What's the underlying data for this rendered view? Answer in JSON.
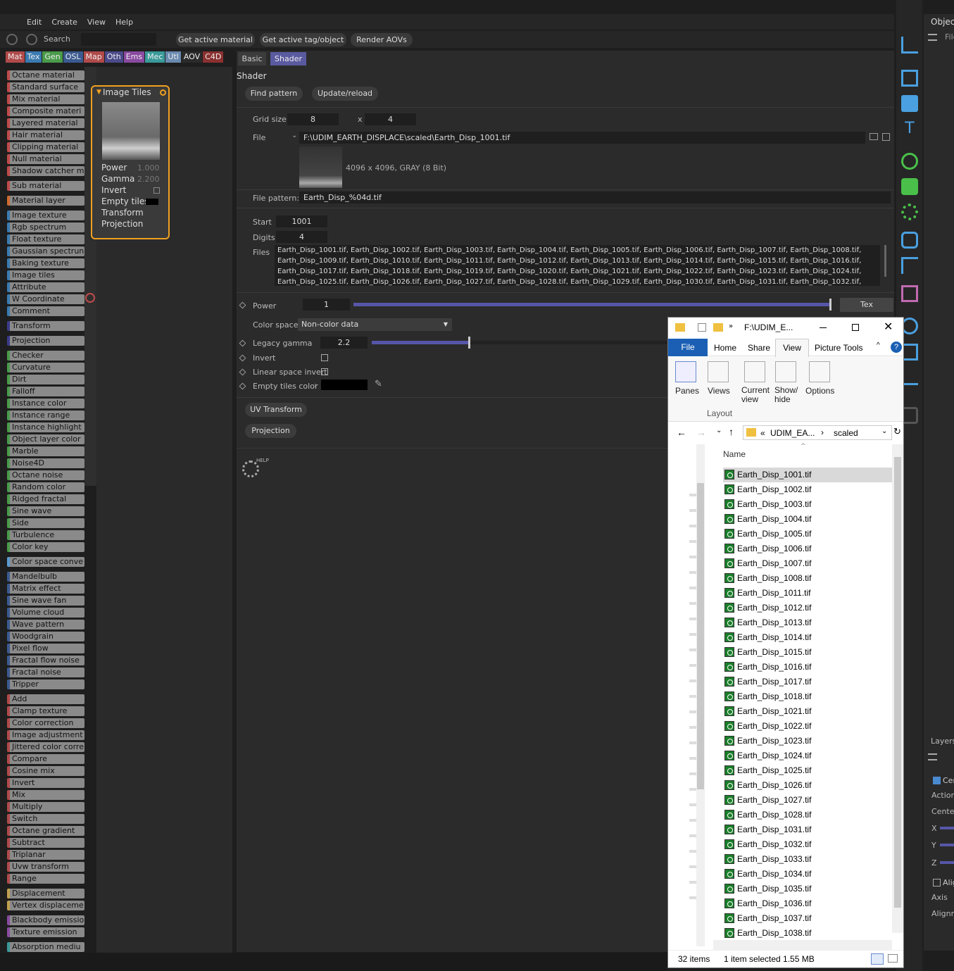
{
  "menu": [
    "Edit",
    "Create",
    "View",
    "Help"
  ],
  "toolbar": {
    "search_label": "Search",
    "get_active_material": "Get active material",
    "get_active_tag": "Get active tag/object",
    "render_aovs": "Render AOVs"
  },
  "tabs": [
    {
      "label": "Mat",
      "color": "#b04a4a"
    },
    {
      "label": "Tex",
      "color": "#3a7ab0"
    },
    {
      "label": "Gen",
      "color": "#4a9a4a"
    },
    {
      "label": "OSL",
      "color": "#3a5a90"
    },
    {
      "label": "Map",
      "color": "#b04a4a"
    },
    {
      "label": "Oth",
      "color": "#4a4a8a"
    },
    {
      "label": "Ems",
      "color": "#8a4aa0"
    },
    {
      "label": "Mec",
      "color": "#3a9a9a"
    },
    {
      "label": "Utl",
      "color": "#6a8ab0"
    },
    {
      "label": "AOV",
      "color": "#2a2a2a"
    },
    {
      "label": "C4D",
      "color": "#8a3030"
    }
  ],
  "node_list": [
    [
      "Octane material",
      "#c04a4a"
    ],
    [
      "Standard surface",
      "#c04a4a"
    ],
    [
      "Mix material",
      "#c04a4a"
    ],
    [
      "Composite materi",
      "#c04a4a"
    ],
    [
      "Layered material",
      "#c04a4a"
    ],
    [
      "Hair material",
      "#c04a4a"
    ],
    [
      "Clipping material",
      "#c04a4a"
    ],
    [
      "Null material",
      "#c04a4a"
    ],
    [
      "Shadow catcher m",
      "#c04a4a"
    ],
    [
      "Sub material",
      "#c04a4a"
    ],
    [
      "Material layer",
      "#d06a30"
    ],
    [
      "Image texture",
      "#3a7ab0"
    ],
    [
      "Rgb spectrum",
      "#3a7ab0"
    ],
    [
      "Float texture",
      "#3a7ab0"
    ],
    [
      "Gaussian spectrun",
      "#3a7ab0"
    ],
    [
      "Baking texture",
      "#3a7ab0"
    ],
    [
      "Image tiles",
      "#3a7ab0"
    ],
    [
      "Attribute",
      "#3a7ab0"
    ],
    [
      "W Coordinate",
      "#3a7ab0"
    ],
    [
      "Comment",
      "#3a7ab0"
    ],
    [
      "Transform",
      "#3a3a8a"
    ],
    [
      "Projection",
      "#3a3a8a"
    ],
    [
      "Checker",
      "#4a9a4a"
    ],
    [
      "Curvature",
      "#4a9a4a"
    ],
    [
      "Dirt",
      "#4a9a4a"
    ],
    [
      "Falloff",
      "#4a9a4a"
    ],
    [
      "Instance color",
      "#4a9a4a"
    ],
    [
      "Instance range",
      "#4a9a4a"
    ],
    [
      "Instance highlight",
      "#4a9a4a"
    ],
    [
      "Object layer color",
      "#4a9a4a"
    ],
    [
      "Marble",
      "#4a9a4a"
    ],
    [
      "Noise4D",
      "#4a9a4a"
    ],
    [
      "Octane noise",
      "#4a9a4a"
    ],
    [
      "Random color",
      "#4a9a4a"
    ],
    [
      "Ridged fractal",
      "#4a9a4a"
    ],
    [
      "Sine wave",
      "#4a9a4a"
    ],
    [
      "Side",
      "#4a9a4a"
    ],
    [
      "Turbulence",
      "#4a9a4a"
    ],
    [
      "Color key",
      "#4a9a4a"
    ],
    [
      "Color space conve",
      "#5a9ad0"
    ],
    [
      "Mandelbulb",
      "#3a5a90"
    ],
    [
      "Matrix effect",
      "#3a5a90"
    ],
    [
      "Sine wave fan",
      "#3a5a90"
    ],
    [
      "Volume cloud",
      "#3a5a90"
    ],
    [
      "Wave pattern",
      "#3a5a90"
    ],
    [
      "Woodgrain",
      "#3a5a90"
    ],
    [
      "Pixel flow",
      "#3a5a90"
    ],
    [
      "Fractal flow noise",
      "#3a5a90"
    ],
    [
      "Fractal noise",
      "#3a5a90"
    ],
    [
      "Tripper",
      "#3a5a90"
    ],
    [
      "Add",
      "#b04a4a"
    ],
    [
      "Clamp texture",
      "#b04a4a"
    ],
    [
      "Color correction",
      "#b04a4a"
    ],
    [
      "Image adjustment",
      "#b04a4a"
    ],
    [
      "Jittered color corre",
      "#b04a4a"
    ],
    [
      "Compare",
      "#b04a4a"
    ],
    [
      "Cosine mix",
      "#b04a4a"
    ],
    [
      "Invert",
      "#b04a4a"
    ],
    [
      "Mix",
      "#b04a4a"
    ],
    [
      "Multiply",
      "#b04a4a"
    ],
    [
      "Switch",
      "#b04a4a"
    ],
    [
      "Octane gradient",
      "#b04a4a"
    ],
    [
      "Subtract",
      "#b04a4a"
    ],
    [
      "Triplanar",
      "#b04a4a"
    ],
    [
      "Uvw transform",
      "#b04a4a"
    ],
    [
      "Range",
      "#b04a4a"
    ],
    [
      "Displacement",
      "#c0a050"
    ],
    [
      "Vertex displaceme",
      "#c0a050"
    ],
    [
      "Blackbody emissio",
      "#8a4aa0"
    ],
    [
      "Texture emission",
      "#8a4aa0"
    ],
    [
      "Absorption mediu",
      "#3a9a9a"
    ]
  ],
  "node": {
    "title": "Image Tiles",
    "power_label": "Power",
    "power_val": "1.000",
    "gamma_label": "Gamma",
    "gamma_val": "2.200",
    "invert": "Invert",
    "empty_tiles": "Empty tiles",
    "transform": "Transform",
    "projection": "Projection"
  },
  "props": {
    "tab_basic": "Basic",
    "tab_shader": "Shader",
    "section": "Shader",
    "find_pattern": "Find pattern",
    "update_reload": "Update/reload",
    "grid_label": "Grid size:",
    "grid_x": "8",
    "grid_sep": "x",
    "grid_y": "4",
    "file_label": "File",
    "file_path": "F:\\UDIM_EARTH_DISPLACE\\scaled\\Earth_Disp_1001.tif",
    "file_info": "4096 x 4096, GRAY (8 Bit)",
    "pattern_label": "File pattern:",
    "pattern": "Earth_Disp_%04d.tif",
    "start_label": "Start",
    "start": "1001",
    "digits_label": "Digits",
    "digits": "4",
    "files_label": "Files",
    "files_l1": "Earth_Disp_1001.tif, Earth_Disp_1002.tif, Earth_Disp_1003.tif, Earth_Disp_1004.tif, Earth_Disp_1005.tif, Earth_Disp_1006.tif, Earth_Disp_1007.tif, Earth_Disp_1008.tif,",
    "files_l2": "Earth_Disp_1009.tif, Earth_Disp_1010.tif, Earth_Disp_1011.tif, Earth_Disp_1012.tif, Earth_Disp_1013.tif, Earth_Disp_1014.tif, Earth_Disp_1015.tif, Earth_Disp_1016.tif,",
    "files_l3": "Earth_Disp_1017.tif, Earth_Disp_1018.tif, Earth_Disp_1019.tif, Earth_Disp_1020.tif, Earth_Disp_1021.tif, Earth_Disp_1022.tif, Earth_Disp_1023.tif, Earth_Disp_1024.tif,",
    "files_l4": "Earth_Disp_1025.tif, Earth_Disp_1026.tif, Earth_Disp_1027.tif, Earth_Disp_1028.tif, Earth_Disp_1029.tif, Earth_Disp_1030.tif, Earth_Disp_1031.tif, Earth_Disp_1032.tif,",
    "power_label": "Power",
    "power": "1",
    "power_fill": 1.0,
    "tex": "Tex",
    "colorspace_label": "Color space",
    "colorspace": "Non-color data",
    "gamma_label": "Legacy gamma",
    "gamma": "2.2",
    "gamma_fill": 0.33,
    "invert_label": "Invert",
    "linear_label": "Linear space invert",
    "empty_label": "Empty tiles color",
    "uv_transform": "UV Transform",
    "projection": "Projection",
    "help": "HELP"
  },
  "objects": {
    "title": "Object",
    "file": "File",
    "layers": "Layers",
    "cen": "Cen",
    "action": "Action",
    "center": "Center",
    "x": "X",
    "y": "Y",
    "z": "Z",
    "align": "Alig",
    "axis": "Axis",
    "alignm": "Alignm"
  },
  "explorer": {
    "title": "F:\\UDIM_E...",
    "tab_file": "File",
    "tab_home": "Home",
    "tab_share": "Share",
    "tab_view": "View",
    "tab_picture": "Picture Tools",
    "panes": "Panes",
    "views": "Views",
    "current_view": "Current\nview",
    "show_hide": "Show/\nhide",
    "options": "Options",
    "layout": "Layout",
    "crumb_parent": "UDIM_EA...",
    "crumb_current": "scaled",
    "col_name": "Name",
    "files": [
      "Earth_Disp_1001.tif",
      "Earth_Disp_1002.tif",
      "Earth_Disp_1003.tif",
      "Earth_Disp_1004.tif",
      "Earth_Disp_1005.tif",
      "Earth_Disp_1006.tif",
      "Earth_Disp_1007.tif",
      "Earth_Disp_1008.tif",
      "Earth_Disp_1011.tif",
      "Earth_Disp_1012.tif",
      "Earth_Disp_1013.tif",
      "Earth_Disp_1014.tif",
      "Earth_Disp_1015.tif",
      "Earth_Disp_1016.tif",
      "Earth_Disp_1017.tif",
      "Earth_Disp_1018.tif",
      "Earth_Disp_1021.tif",
      "Earth_Disp_1022.tif",
      "Earth_Disp_1023.tif",
      "Earth_Disp_1024.tif",
      "Earth_Disp_1025.tif",
      "Earth_Disp_1026.tif",
      "Earth_Disp_1027.tif",
      "Earth_Disp_1028.tif",
      "Earth_Disp_1031.tif",
      "Earth_Disp_1032.tif",
      "Earth_Disp_1033.tif",
      "Earth_Disp_1034.tif",
      "Earth_Disp_1035.tif",
      "Earth_Disp_1036.tif",
      "Earth_Disp_1037.tif",
      "Earth_Disp_1038.tif"
    ],
    "selected_index": 0,
    "item_count": "32 items",
    "selection": "1 item selected  1.55 MB"
  }
}
